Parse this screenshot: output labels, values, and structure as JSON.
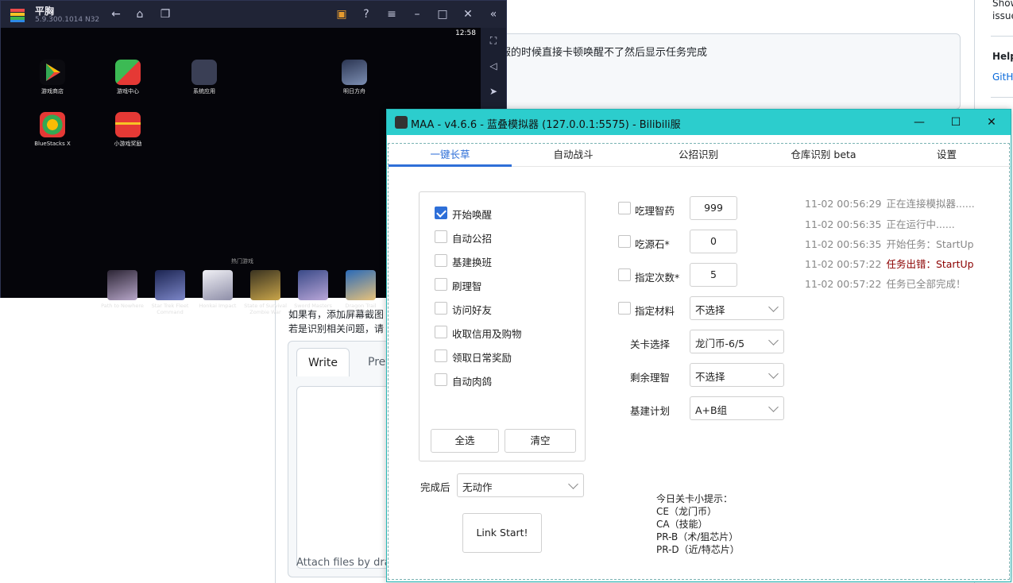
{
  "github": {
    "textarea_text": "国服的时候直接卡顿唤醒不了然后显示任务完成",
    "right_sidebar": {
      "line1": "Show",
      "line2": "issue",
      "help_title": "Help",
      "help_link": "GitH"
    },
    "help_line1": "如果有，添加屏幕截图",
    "help_line2": "若是识别相关问题，请",
    "editor": {
      "tab_write": "Write",
      "tab_preview": "Prev",
      "attach_text": "Attach files by dra"
    }
  },
  "bluestacks": {
    "title": "平胸",
    "version": "5.9.300.1014  N32",
    "clock": "12:58",
    "apps": [
      {
        "label": "游戏商店",
        "color": "#1a73e8"
      },
      {
        "label": "游戏中心",
        "color": "#3cba54"
      },
      {
        "label": "系统应用",
        "color": "#4a4a4a"
      },
      {
        "label": "明日方舟",
        "color": "#4a5a7a"
      },
      {
        "label": "BlueStacks X",
        "color": "#34a853"
      },
      {
        "label": "小游戏奖励",
        "color": "#e53935"
      }
    ],
    "dock_title": "热门游戏",
    "games": [
      {
        "label": "Path to Nowhere",
        "color": "#6a5a7a"
      },
      {
        "label": "Star Trek Fleet Command",
        "color": "#3a4a8a"
      },
      {
        "label": "Honkai Impact",
        "color": "#c8c8d8"
      },
      {
        "label": "State of Survival Zombie War",
        "color": "#8a7a3a"
      },
      {
        "label": "Sword Masters",
        "color": "#5a6aa8"
      },
      {
        "label": "Dragon Trail Hunter World",
        "color": "#4a8ac8"
      }
    ]
  },
  "maa": {
    "title": "MAA - v4.6.6 - 蓝叠模拟器 (127.0.0.1:5575) - Bilibili服",
    "tabs": [
      {
        "label": "一键长草",
        "active": true
      },
      {
        "label": "自动战斗",
        "active": false
      },
      {
        "label": "公招识别",
        "active": false
      },
      {
        "label": "仓库识别 beta",
        "active": false
      },
      {
        "label": "设置",
        "active": false
      }
    ],
    "tasks": [
      {
        "label": "开始唤醒",
        "checked": true
      },
      {
        "label": "自动公招",
        "checked": false
      },
      {
        "label": "基建换班",
        "checked": false
      },
      {
        "label": "刷理智",
        "checked": false
      },
      {
        "label": "访问好友",
        "checked": false
      },
      {
        "label": "收取信用及购物",
        "checked": false
      },
      {
        "label": "领取日常奖励",
        "checked": false
      },
      {
        "label": "自动肉鸽",
        "checked": false
      }
    ],
    "select_all": "全选",
    "clear": "清空",
    "after_complete_label": "完成后",
    "after_complete_value": "无动作",
    "link_start": "Link Start!",
    "options": {
      "medicine_label": "吃理智药",
      "medicine_value": "999",
      "stone_label": "吃源石*",
      "stone_value": "0",
      "times_label": "指定次数*",
      "times_value": "5",
      "material_label": "指定材料",
      "material_value": "不选择",
      "stage_label": "关卡选择",
      "stage_value": "龙门币-6/5",
      "remain_label": "剩余理智",
      "remain_value": "不选择",
      "infrast_label": "基建计划",
      "infrast_value": "A+B组"
    },
    "logs": [
      {
        "time": "11-02  00:56:29",
        "msg": "正在连接模拟器......",
        "error": false
      },
      {
        "time": "11-02  00:56:35",
        "msg": "正在运行中......",
        "error": false
      },
      {
        "time": "11-02  00:56:35",
        "msg": "开始任务：StartUp",
        "error": false
      },
      {
        "time": "11-02  00:57:22",
        "msg": "任务出错：StartUp",
        "error": true
      },
      {
        "time": "11-02  00:57:22",
        "msg": "任务已全部完成！",
        "error": false
      }
    ],
    "tips": {
      "title": "今日关卡小提示：",
      "lines": [
        "CE（龙门币）",
        "CA（技能）",
        "PR-B（术/狙芯片）",
        "PR-D（近/特芯片）"
      ]
    },
    "accent_color": "#2e6fd8",
    "titlebar_color": "#2ccdcd"
  }
}
